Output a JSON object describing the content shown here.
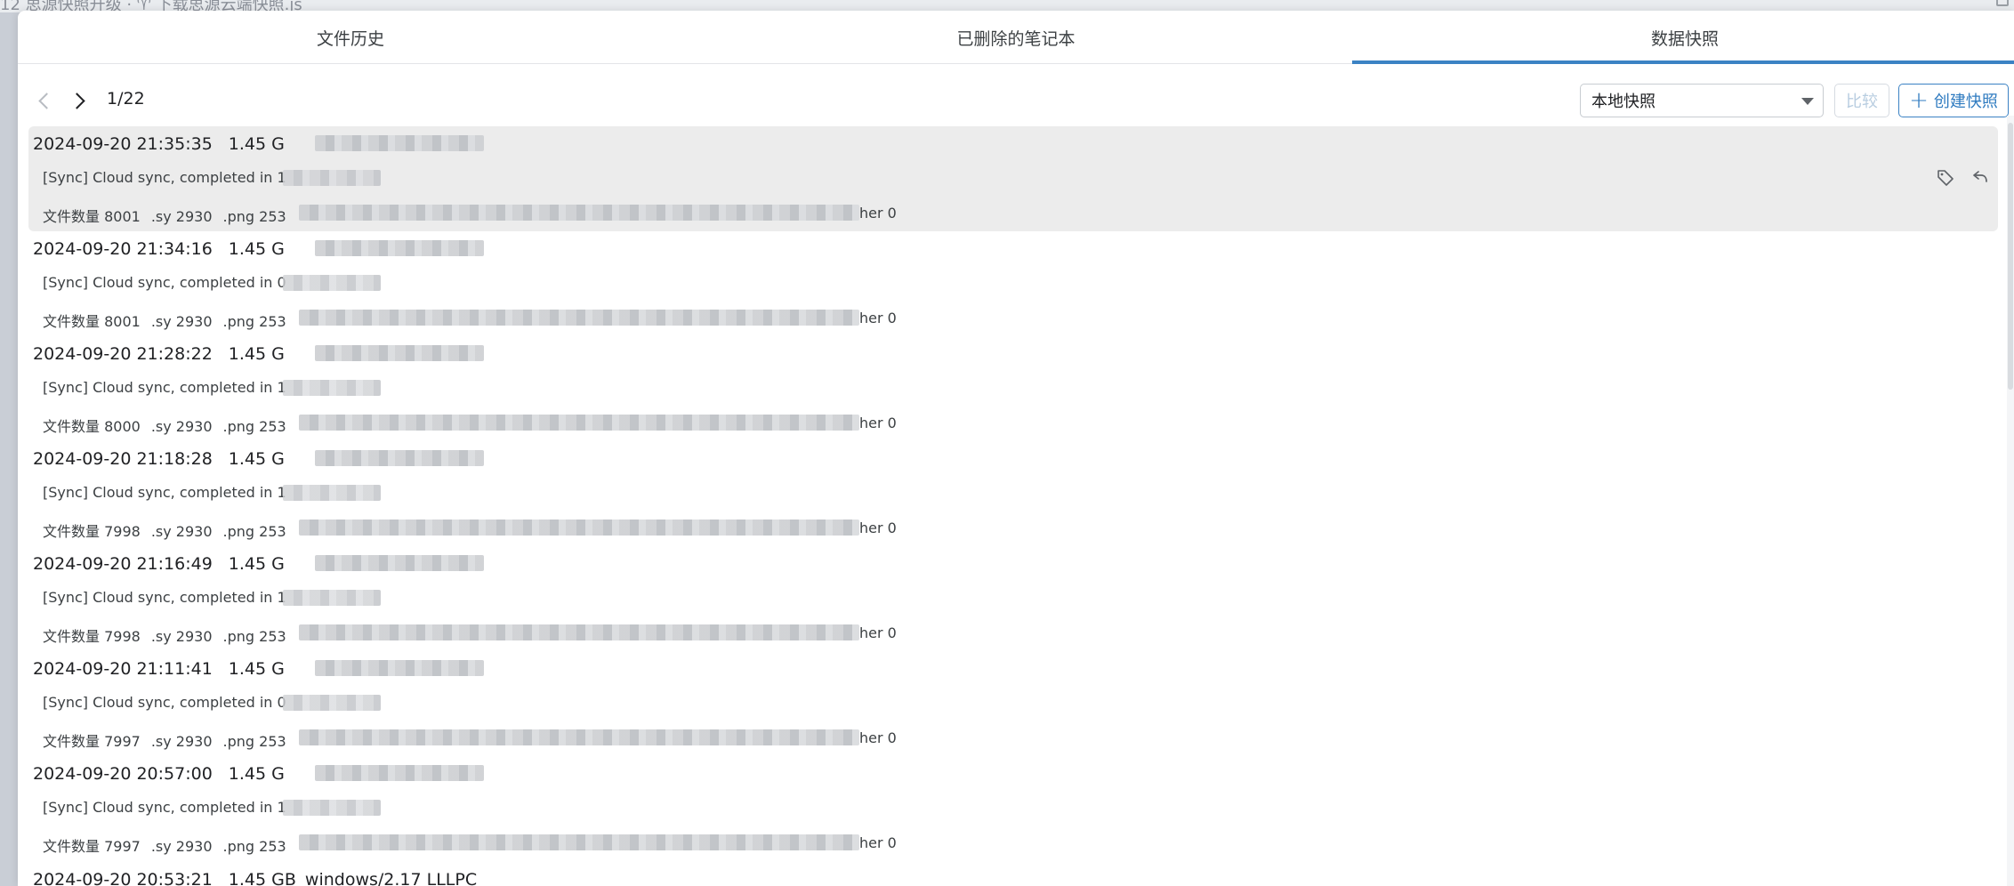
{
  "window": {
    "top_strip_text": "12 思源快照升级 ·  ♈ 下载思源云端快照.js"
  },
  "tabs": [
    {
      "label": "文件历史"
    },
    {
      "label": "已删除的笔记本"
    },
    {
      "label": "数据快照",
      "active": true
    }
  ],
  "toolbar": {
    "page": "1/22",
    "repo_select": "本地快照",
    "compare_label": "比较",
    "create_label": "创建快照"
  },
  "snapshots": [
    {
      "time": "2024-09-20 21:35:35",
      "size": "1.45 G",
      "sync": "[Sync] Cloud sync, completed in 1",
      "files": "文件数量 8001",
      "sy": ".sy 2930",
      "png": ".png 253",
      "tail": "her 0",
      "selected": true
    },
    {
      "time": "2024-09-20 21:34:16",
      "size": "1.45 G",
      "sync": "[Sync] Cloud sync, completed in 0",
      "files": "文件数量 8001",
      "sy": ".sy 2930",
      "png": ".png 253",
      "tail": "her 0"
    },
    {
      "time": "2024-09-20 21:28:22",
      "size": "1.45 G",
      "sync": "[Sync] Cloud sync, completed in 1",
      "files": "文件数量 8000",
      "sy": ".sy 2930",
      "png": ".png 253",
      "tail": "her 0"
    },
    {
      "time": "2024-09-20 21:18:28",
      "size": "1.45 G",
      "sync": "[Sync] Cloud sync, completed in 1",
      "files": "文件数量 7998",
      "sy": ".sy 2930",
      "png": ".png 253",
      "tail": "her 0"
    },
    {
      "time": "2024-09-20 21:16:49",
      "size": "1.45 G",
      "sync": "[Sync] Cloud sync, completed in 1",
      "files": "文件数量 7998",
      "sy": ".sy 2930",
      "png": ".png 253",
      "tail": "her 0"
    },
    {
      "time": "2024-09-20 21:11:41",
      "size": "1.45 G",
      "sync": "[Sync] Cloud sync, completed in 0",
      "files": "文件数量 7997",
      "sy": ".sy 2930",
      "png": ".png 253",
      "tail": "her 0"
    },
    {
      "time": "2024-09-20 20:57:00",
      "size": "1.45 G",
      "sync": "[Sync] Cloud sync, completed in 1",
      "files": "文件数量 7997",
      "sy": ".sy 2930",
      "png": ".png 253",
      "tail": "her 0"
    }
  ],
  "partial_snapshot": {
    "time": "2024-09-20 20:53:21",
    "size": "1.45 GB",
    "memo": "windows/2.17 LLLPC"
  },
  "colors": {
    "accent": "#3b82c4",
    "selected_row": "#ececec"
  },
  "icons": {
    "tag": "tag-icon",
    "rollback": "rollback-icon",
    "prev": "chevron-left-icon",
    "next": "chevron-right-icon",
    "dropdown": "caret-down-icon",
    "plus": "plus-icon"
  }
}
